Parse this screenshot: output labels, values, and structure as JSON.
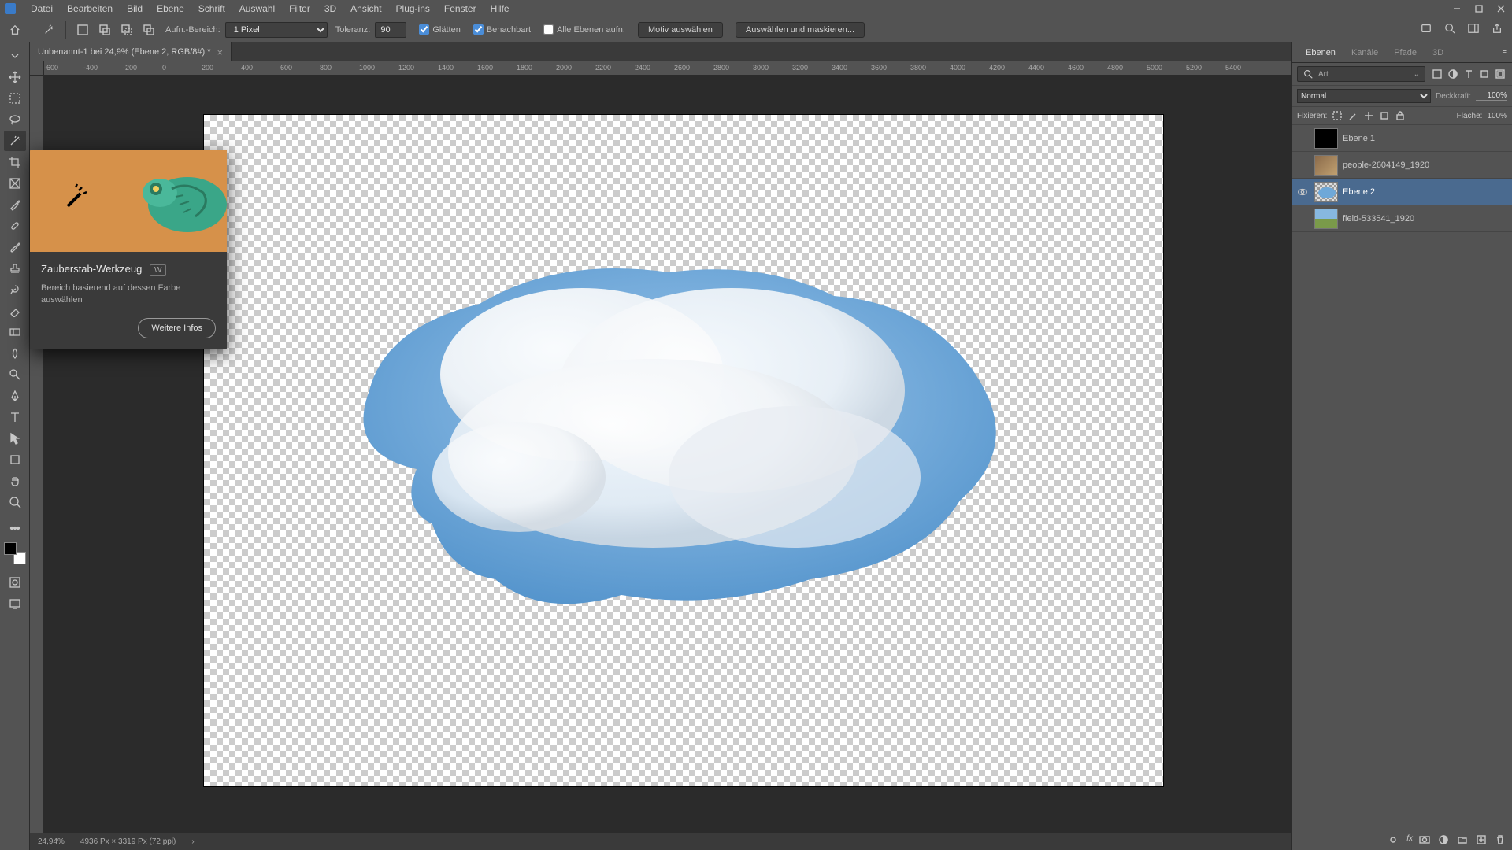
{
  "menu": {
    "items": [
      "Datei",
      "Bearbeiten",
      "Bild",
      "Ebene",
      "Schrift",
      "Auswahl",
      "Filter",
      "3D",
      "Ansicht",
      "Plug-ins",
      "Fenster",
      "Hilfe"
    ]
  },
  "options": {
    "sample_label": "Aufn.-Bereich:",
    "sample_value": "1 Pixel",
    "tolerance_label": "Toleranz:",
    "tolerance_value": "90",
    "antialias": "Glätten",
    "contiguous": "Benachbart",
    "all_layers": "Alle Ebenen aufn.",
    "select_subject": "Motiv auswählen",
    "select_mask": "Auswählen und maskieren..."
  },
  "document": {
    "tab_title": "Unbenannt-1 bei 24,9% (Ebene 2, RGB/8#) *",
    "zoom": "24,94%",
    "dimensions": "4936 Px × 3319 Px (72 ppi)"
  },
  "ruler_ticks": [
    "-600",
    "-400",
    "-200",
    "0",
    "200",
    "400",
    "600",
    "800",
    "1000",
    "1200",
    "1400",
    "1600",
    "1800",
    "2000",
    "2200",
    "2400",
    "2600",
    "2800",
    "3000",
    "3200",
    "3400",
    "3600",
    "3800",
    "4000",
    "4200",
    "4400",
    "4600",
    "4800",
    "5000",
    "5200",
    "5400"
  ],
  "tooltip": {
    "title": "Zauberstab-Werkzeug",
    "key": "W",
    "desc": "Bereich basierend auf dessen Farbe auswählen",
    "more": "Weitere Infos"
  },
  "panels": {
    "tabs": [
      "Ebenen",
      "Kanäle",
      "Pfade",
      "3D"
    ],
    "search_placeholder": "Art",
    "blend_mode": "Normal",
    "opacity_label": "Deckkraft:",
    "opacity_value": "100%",
    "lock_label": "Fixieren:",
    "fill_label": "Fläche:",
    "fill_value": "100%",
    "layers": [
      {
        "name": "Ebene 1",
        "visible": false,
        "thumb": "black"
      },
      {
        "name": "people-2604149_1920",
        "visible": false,
        "thumb": "photo1"
      },
      {
        "name": "Ebene 2",
        "visible": true,
        "thumb": "cloud",
        "selected": true
      },
      {
        "name": "field-533541_1920",
        "visible": false,
        "thumb": "photo2"
      }
    ]
  }
}
